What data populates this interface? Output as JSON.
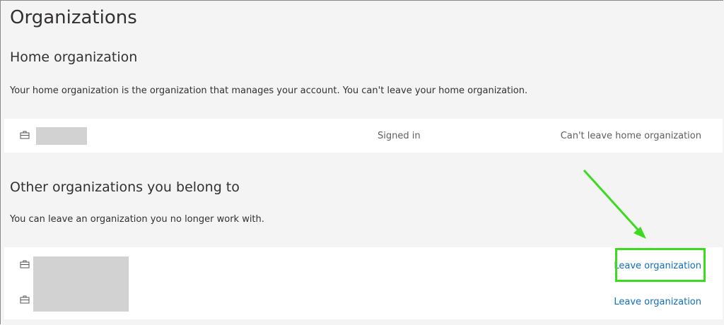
{
  "page": {
    "title": "Organizations"
  },
  "home": {
    "heading": "Home organization",
    "description": "Your home organization is the organization that manages your account. You can't leave your home organization.",
    "row": {
      "icon": "briefcase-icon",
      "status": "Signed in",
      "action": "Can't leave home organization"
    }
  },
  "others": {
    "heading": "Other organizations you belong to",
    "description": "You can leave an organization you no longer work with.",
    "rows": [
      {
        "icon": "briefcase-icon",
        "action": "Leave organization"
      },
      {
        "icon": "briefcase-icon",
        "action": "Leave organization"
      }
    ]
  },
  "annotation": {
    "color": "#3bdc1f",
    "arrow": "arrow-icon"
  }
}
